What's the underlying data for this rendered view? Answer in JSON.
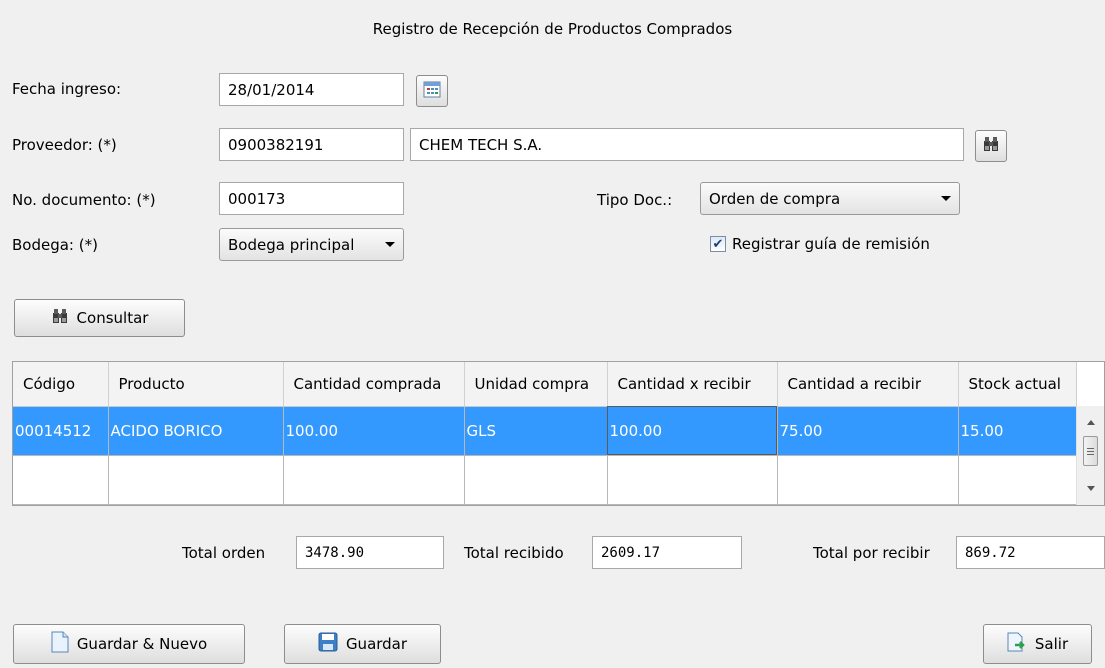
{
  "form": {
    "title": "Registro de Recepción de Productos Comprados",
    "fecha_label": "Fecha ingreso:",
    "fecha_value": "28/01/2014",
    "proveedor_label": "Proveedor: (*)",
    "proveedor_code": "0900382191",
    "proveedor_name": "CHEM TECH S.A.",
    "documento_label": "No. documento: (*)",
    "documento_value": "000173",
    "tipodoc_label": "Tipo Doc.:",
    "tipodoc_value": "Orden de compra",
    "bodega_label": "Bodega: (*)",
    "bodega_value": "Bodega principal",
    "guia_label": "Registrar guía de remisión",
    "guia_checked": true,
    "consultar_label": "Consultar"
  },
  "grid": {
    "columns": [
      "Código",
      "Producto",
      "Cantidad comprada",
      "Unidad compra",
      "Cantidad x recibir",
      "Cantidad a recibir",
      "Stock actual"
    ],
    "rows": [
      [
        "00014512",
        "ACIDO BORICO",
        "100.00",
        "GLS",
        "100.00",
        "75.00",
        "15.00"
      ],
      [
        "",
        "",
        "",
        "",
        "",
        "",
        ""
      ]
    ],
    "selected_row": 0
  },
  "totals": {
    "orden_label": "Total orden",
    "orden_value": "3478.90",
    "recibido_label": "Total recibido",
    "recibido_value": "2609.17",
    "por_recibir_label": "Total por recibir",
    "por_recibir_value": "869.72"
  },
  "buttons": {
    "guardar_nuevo": "Guardar & Nuevo",
    "guardar": "Guardar",
    "salir": "Salir"
  },
  "colors": {
    "selection": "#3399ff",
    "background": "#f0f0f0"
  },
  "icons": [
    "calendar-icon",
    "binoculars-icon",
    "dropdown-arrow-icon",
    "checkbox-check-icon",
    "document-icon",
    "floppy-disk-icon",
    "exit-icon"
  ]
}
